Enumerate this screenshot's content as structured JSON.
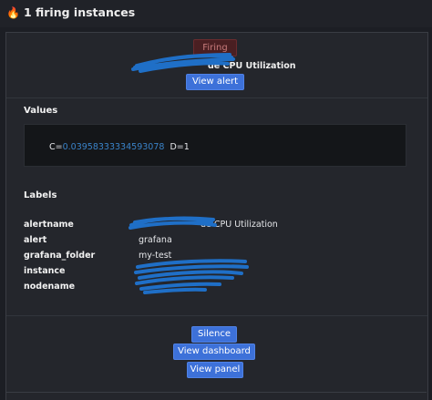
{
  "header": {
    "icon": "fire-icon",
    "title": "1 firing instances"
  },
  "instance": {
    "state": "Firing",
    "alert_name_visible": "de CPU Utilization",
    "view_alert_label": "View alert"
  },
  "values": {
    "title": "Values",
    "c_label": "C=",
    "c_value": "0.03958333334593078",
    "d_text": "D=1"
  },
  "labels": {
    "title": "Labels",
    "rows": [
      {
        "key": "alertname",
        "value": "de CPU Utilization"
      },
      {
        "key": "alert",
        "value": "grafana"
      },
      {
        "key": "grafana_folder",
        "value": "my-test"
      },
      {
        "key": "instance",
        "value": ""
      },
      {
        "key": "nodename",
        "value": ""
      }
    ]
  },
  "actions": {
    "silence": "Silence",
    "view_dashboard": "View dashboard",
    "view_panel": "View panel"
  },
  "colors": {
    "accent": "#3d71d9",
    "firing_badge": "#4a1f22",
    "value_highlight": "#3a83c9",
    "redaction": "#1f6fc7"
  }
}
